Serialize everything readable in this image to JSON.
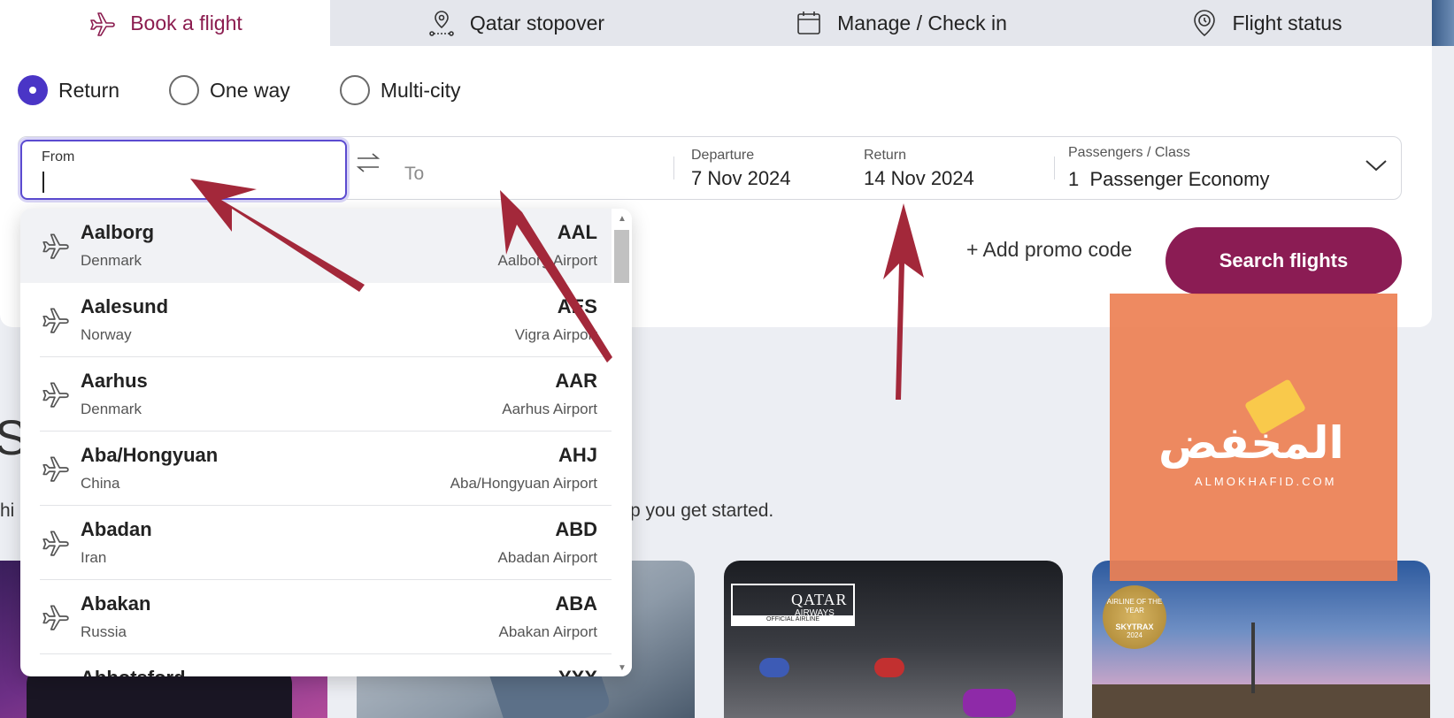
{
  "tabs": [
    {
      "label": "Book a flight",
      "icon": "plane-icon",
      "active": true
    },
    {
      "label": "Qatar stopover",
      "icon": "map-pin-route-icon",
      "active": false
    },
    {
      "label": "Manage / Check in",
      "icon": "calendar-icon",
      "active": false
    },
    {
      "label": "Flight status",
      "icon": "location-clock-icon",
      "active": false
    }
  ],
  "trip_types": [
    {
      "label": "Return",
      "checked": true
    },
    {
      "label": "One way",
      "checked": false
    },
    {
      "label": "Multi-city",
      "checked": false
    }
  ],
  "search": {
    "from_label": "From",
    "from_value": "",
    "to_placeholder": "To",
    "departure_label": "Departure",
    "departure_value": "7 Nov 2024",
    "return_label": "Return",
    "return_value": "14 Nov 2024",
    "passengers_label": "Passengers / Class",
    "passengers_value": "1  Passenger Economy"
  },
  "promo_label": "+ Add promo code",
  "search_button": "Search flights",
  "background": {
    "title_fragment": "St",
    "sub_left": "hi",
    "sub_right": "p you get started."
  },
  "cards": {
    "card3_logo_name": "QATAR",
    "card3_logo_sub": "AIRWAYS",
    "card3_logo_bar": "OFFICIAL AIRLINE",
    "card4_badge_top": "AIRLINE OF THE YEAR",
    "card4_badge_mid": "SKYTRAX",
    "card4_badge_year": "2024"
  },
  "watermark": {
    "arabic": "المخفض",
    "latin": "ALMOKHAFID.COM"
  },
  "airports": [
    {
      "city": "Aalborg",
      "country": "Denmark",
      "code": "AAL",
      "airport": "Aalborg Airport"
    },
    {
      "city": "Aalesund",
      "country": "Norway",
      "code": "AES",
      "airport": "Vigra Airport"
    },
    {
      "city": "Aarhus",
      "country": "Denmark",
      "code": "AAR",
      "airport": "Aarhus Airport"
    },
    {
      "city": "Aba/Hongyuan",
      "country": "China",
      "code": "AHJ",
      "airport": "Aba/Hongyuan Airport"
    },
    {
      "city": "Abadan",
      "country": "Iran",
      "code": "ABD",
      "airport": "Abadan Airport"
    },
    {
      "city": "Abakan",
      "country": "Russia",
      "code": "ABA",
      "airport": "Abakan Airport"
    },
    {
      "city": "Abbotsford",
      "country": "",
      "code": "YXX",
      "airport": ""
    }
  ],
  "colors": {
    "brand": "#8b1c54",
    "focus": "#5b4bd0",
    "radio_checked": "#4a35c6",
    "annotation_arrow": "#a3283a",
    "watermark": "#ed8054"
  }
}
